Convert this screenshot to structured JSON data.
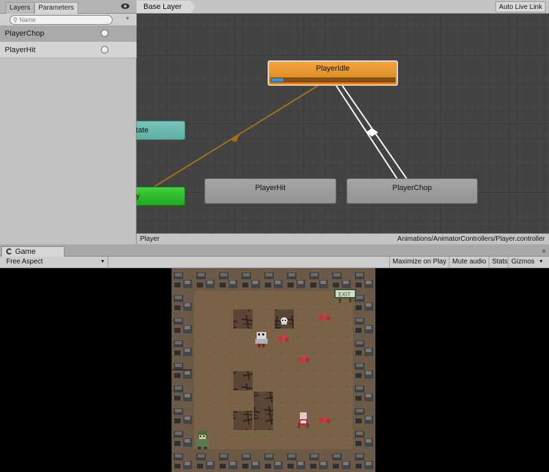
{
  "animator": {
    "tabs": [
      {
        "label": "Layers"
      },
      {
        "label": "Parameters"
      }
    ],
    "search": {
      "placeholder": "Name"
    },
    "parameters": [
      {
        "name": "PlayerChop"
      },
      {
        "name": "PlayerHit"
      }
    ],
    "breadcrumb": "Base Layer",
    "auto_live_link": "Auto Live Link",
    "footer_left": "Player",
    "footer_right": "Animations/AnimatorControllers/Player.controller",
    "states": {
      "idle": "PlayerIdle",
      "hit": "PlayerHit",
      "chop": "PlayerChop",
      "any_state_partial": "tate",
      "entry_partial": "y"
    },
    "idle_progress": 0.1,
    "colors": {
      "default_state": "#e2921f",
      "any_state": "#6cbbb0",
      "entry": "#2bb52b",
      "transition_wire": "#a5701a"
    }
  },
  "game": {
    "tab_label": "Game",
    "aspect": "Free Aspect",
    "toolbar": {
      "maximize": "Maximize on Play",
      "mute": "Mute audio",
      "stats": "Stats",
      "gizmos": "Gizmos"
    },
    "exit_sign": "EXIT"
  }
}
